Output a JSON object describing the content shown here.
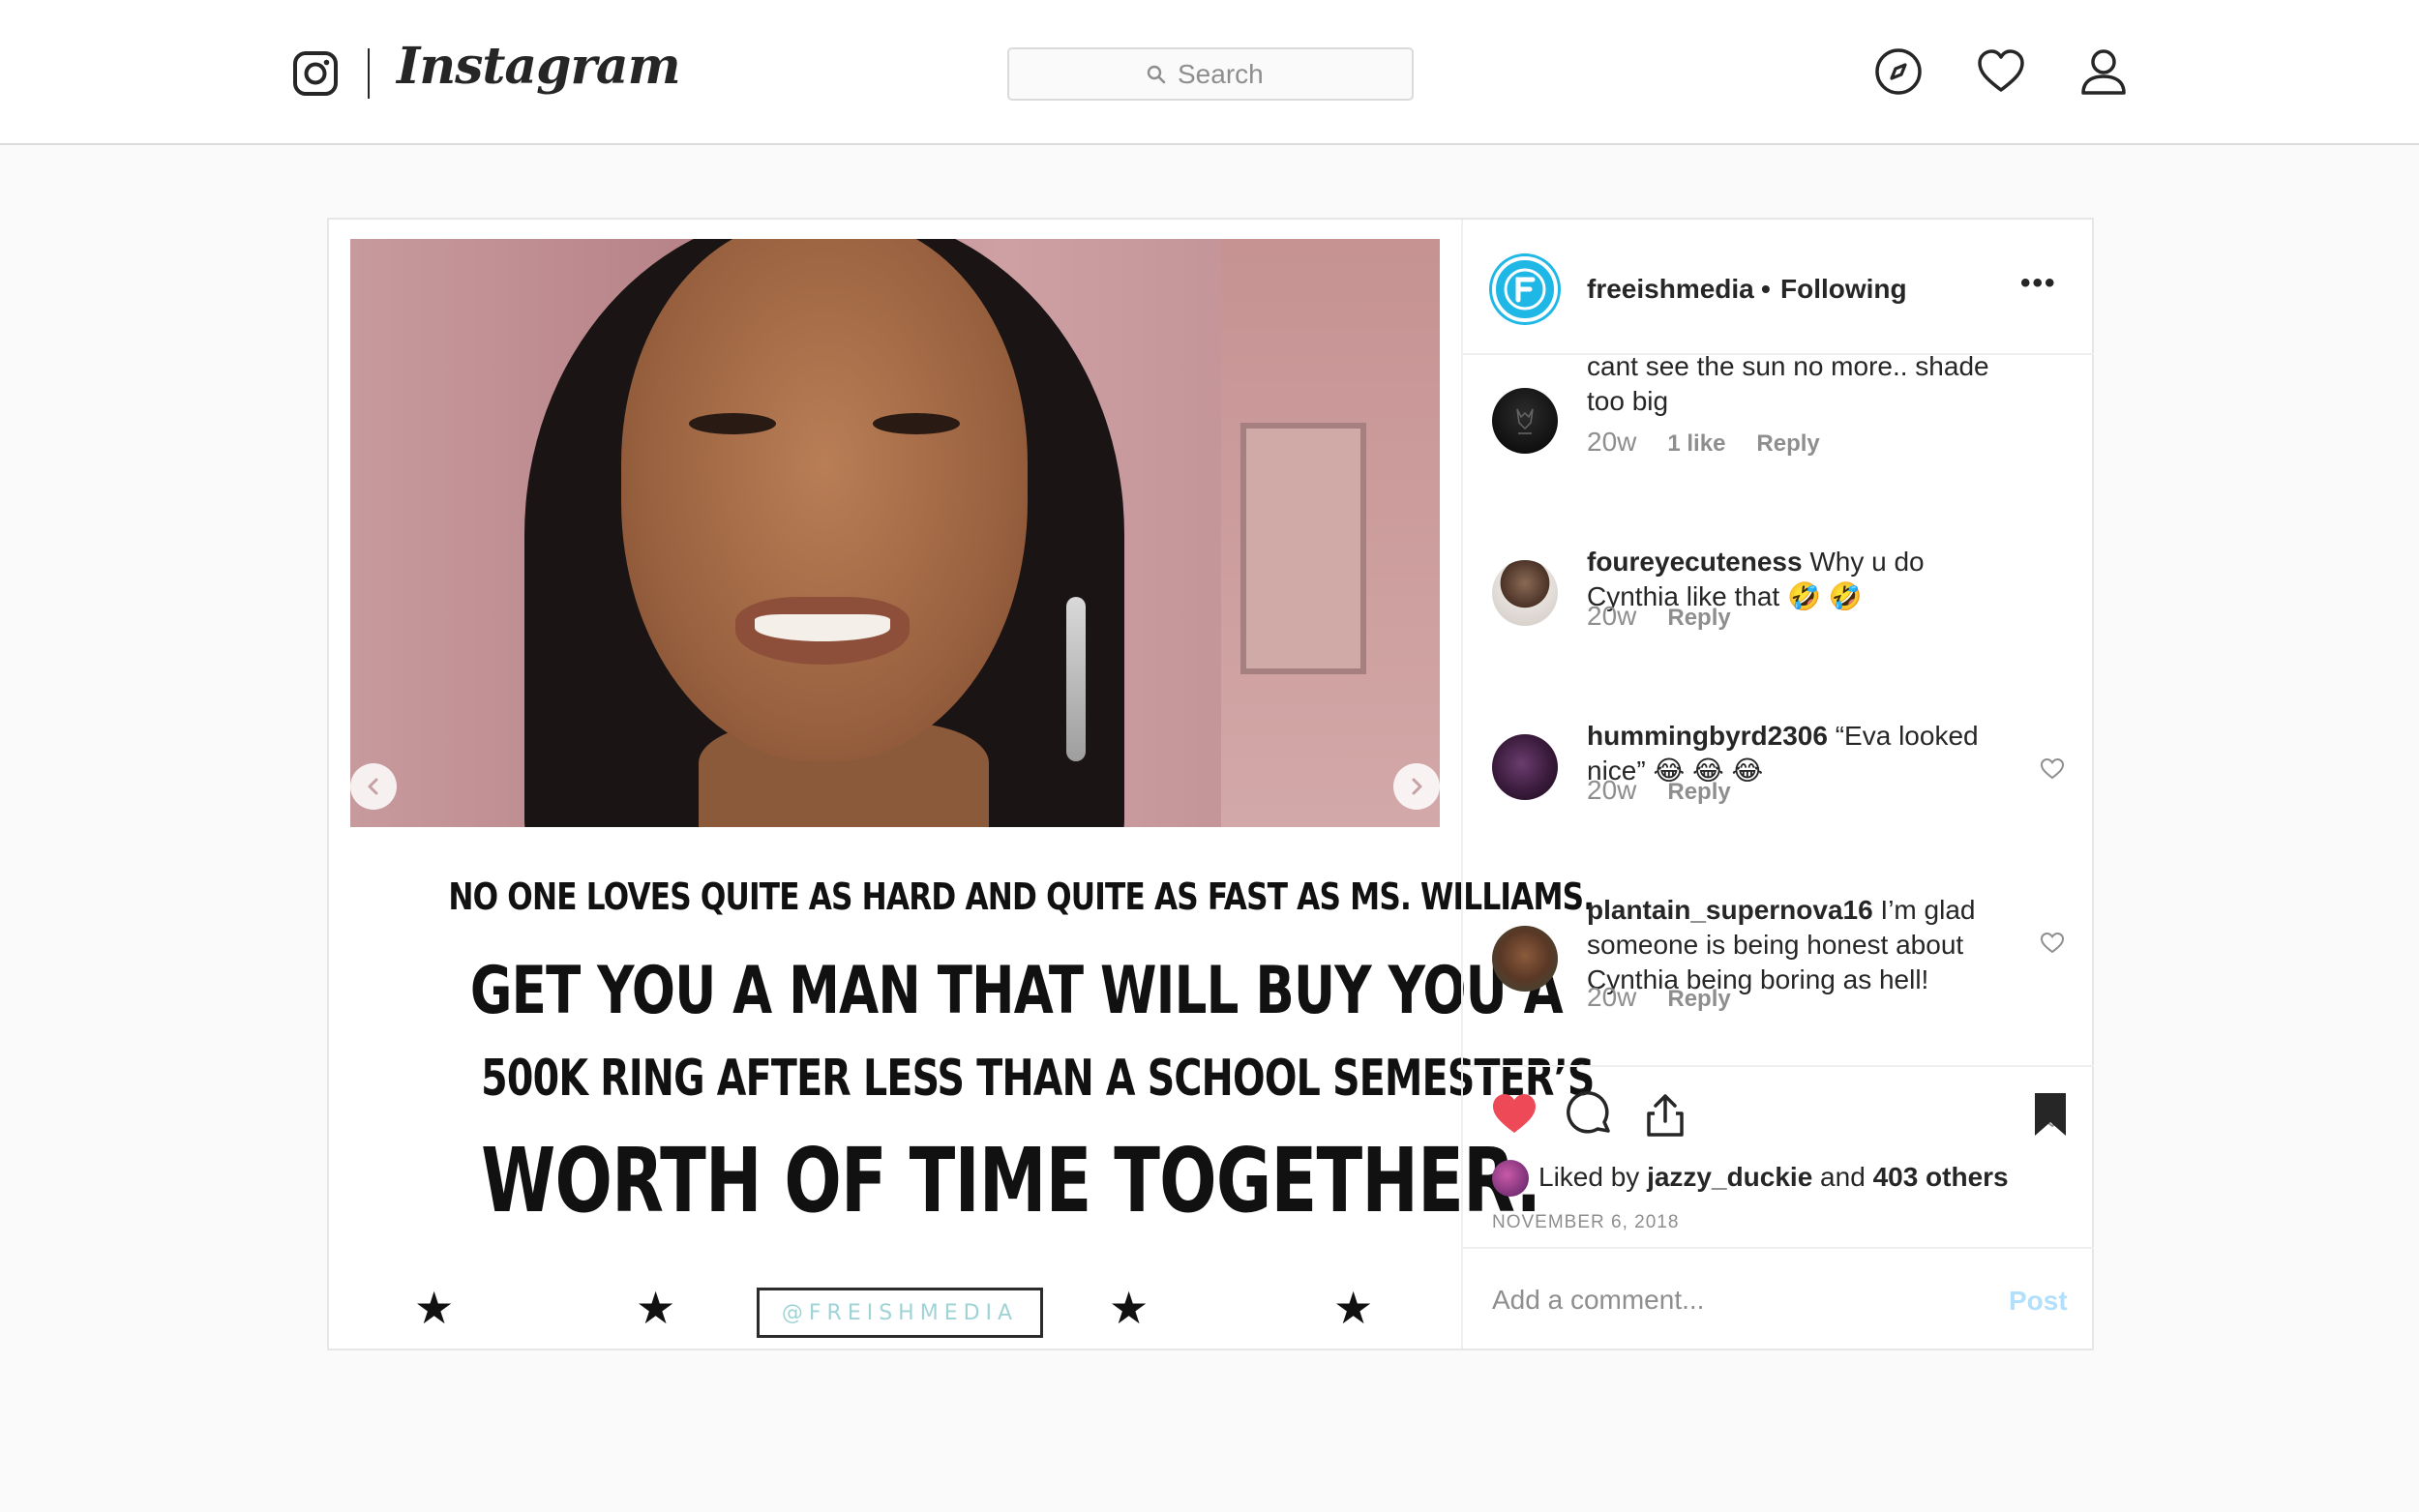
{
  "nav": {
    "brand": "Instagram",
    "search_placeholder": "Search",
    "icons": [
      "instagram-logo-icon",
      "search-icon",
      "compass-icon",
      "heart-icon",
      "profile-icon"
    ]
  },
  "post": {
    "image_caption": {
      "line1": "NO ONE LOVES QUITE AS HARD AND QUITE AS FAST AS MS. WILLIAMS.",
      "line2": "GET YOU A MAN THAT WILL BUY YOU A",
      "line3": "500K RING AFTER LESS THAN A SCHOOL SEMESTER’S",
      "line4": "WORTH OF TIME TOGETHER.",
      "stars": [
        "★",
        "★",
        "★",
        "★"
      ],
      "watermark": "@FREISHMEDIA"
    },
    "author": {
      "username": "freeishmedia",
      "separator": "•",
      "follow_status": "Following"
    },
    "comments": [
      {
        "username": "",
        "text": "cant see the sun no more.. shade too big",
        "time": "20w",
        "likes": "1 like",
        "reply": "Reply"
      },
      {
        "username": "foureyecuteness",
        "text": " Why u do Cynthia like that 🤣 🤣",
        "time": "20w",
        "reply": "Reply"
      },
      {
        "username": "hummingbyrd2306",
        "text": " “Eva looked nice” 😂 😂 😂",
        "time": "20w",
        "reply": "Reply"
      },
      {
        "username": "plantain_supernova16",
        "text": " I’m glad someone is being honest about Cynthia being boring as hell!",
        "time": "20w",
        "reply": "Reply"
      }
    ],
    "likes": {
      "prefix": "Liked by ",
      "user": "jazzy_duckie",
      "middle": " and ",
      "others": "403 others"
    },
    "date": "NOVEMBER 6, 2018",
    "comment_placeholder": "Add a comment...",
    "post_button": "Post"
  },
  "colors": {
    "like_red": "#ed4956",
    "link_blue_disabled": "#b2dffc",
    "avatar_blue": "#1fb7e6",
    "watermark_teal": "#9fd3d6"
  }
}
